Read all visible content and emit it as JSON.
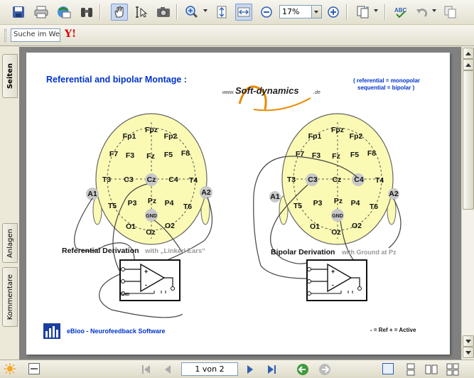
{
  "toolbar": {
    "zoom_value": "17%",
    "icons": [
      "save-icon",
      "print-icon",
      "email-icon",
      "search-binoculars-icon",
      "hand-tool-icon",
      "select-text-icon",
      "snapshot-icon",
      "zoom-in-icon",
      "fit-height-icon",
      "fit-width-icon",
      "zoom-out-minus-icon",
      "zoom-in-plus-icon",
      "page-layout-icon",
      "spellcheck-icon",
      "undo-icon",
      "copy-icon"
    ]
  },
  "search_toolbar": {
    "search_placeholder": "Suche im Web",
    "yahoo_label": "Y!"
  },
  "side_tabs": {
    "pages": "Seiten",
    "attachments": "Anlagen",
    "comments": "Kommentare"
  },
  "document": {
    "title": "Referential and bipolar Montage :",
    "logo_text": "Soft-dynamics",
    "logo_prefix": "www.",
    "logo_suffix": ".de",
    "legend_line1": "( referential  =  monopolar",
    "legend_line2": "sequential  =  bipolar        )",
    "left_label_main": "Referential Derivation",
    "left_label_sub": "with „Linked Ears“",
    "right_label_main": "Bipolar Derivation",
    "right_label_sub": "with Ground at Pz",
    "footer_brand": "eBioo - Neurofeedback Software",
    "footer_legend": "-  =  Ref     +  =  Active",
    "electrodes": {
      "fpz": "Fpz",
      "fp1": "Fp1",
      "fp2": "Fp2",
      "f7": "F7",
      "f3": "F3",
      "fz": "Fz",
      "f4": "F5",
      "f8": "F8",
      "t3": "T3",
      "c3": "C3",
      "cz": "Cz",
      "c4": "C4",
      "t4": "T4",
      "a1": "A1",
      "a2": "A2",
      "t5": "T5",
      "p3": "P3",
      "pz": "Pz",
      "p4": "P4",
      "t6": "T6",
      "gnd": "GND",
      "o1": "O1",
      "oz": "Oz",
      "o2": "O2"
    },
    "amp_plus": "+",
    "amp_minus": "-",
    "amp_gnd": "GND"
  },
  "statusbar": {
    "page_indicator": "1 von 2"
  },
  "colors": {
    "title_blue": "#0033cc",
    "head_fill": "#fafab4",
    "electrode_gray": "#c8c8c8",
    "logo_orange": "#e88a00"
  }
}
